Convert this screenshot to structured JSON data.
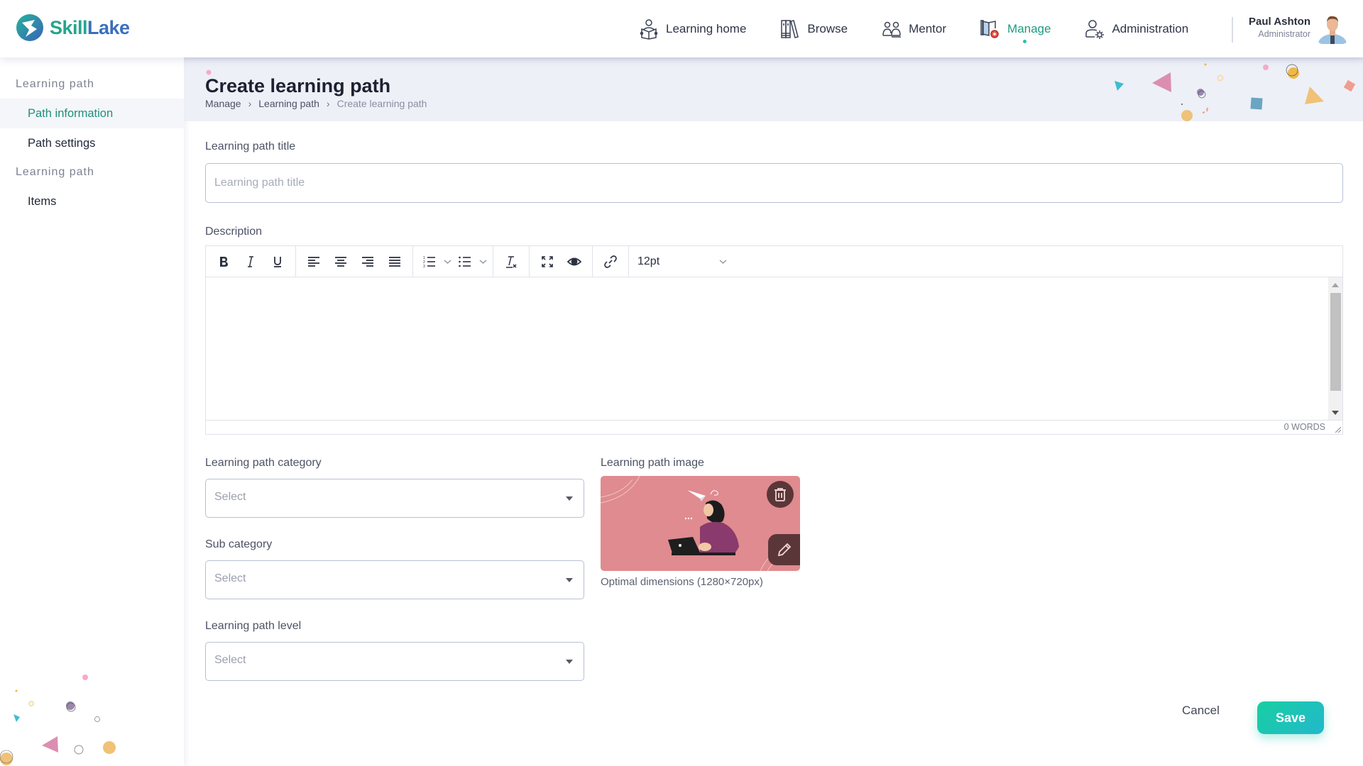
{
  "app": {
    "brand_part1": "Skill",
    "brand_part2": "Lake",
    "colors": {
      "accent": "#1f9a80",
      "brand_green": "#25a58c",
      "brand_blue": "#3a6fbd",
      "save_start": "#18cfa2",
      "save_end": "#22b8cc"
    }
  },
  "nav": {
    "items": [
      {
        "label": "Learning home",
        "icon": "reading-person-icon",
        "active": false
      },
      {
        "label": "Browse",
        "icon": "bookshelf-icon",
        "active": false
      },
      {
        "label": "Mentor",
        "icon": "people-icon",
        "active": false
      },
      {
        "label": "Manage",
        "icon": "book-gear-icon",
        "active": true
      },
      {
        "label": "Administration",
        "icon": "user-gear-icon",
        "active": false
      }
    ]
  },
  "user": {
    "name": "Paul Ashton",
    "role": "Administrator"
  },
  "sidebar": {
    "sections": [
      {
        "title": "Learning path",
        "items": [
          {
            "label": "Path information",
            "active": true
          },
          {
            "label": "Path settings",
            "active": false
          }
        ]
      },
      {
        "title": "Learning path",
        "items": [
          {
            "label": "Items",
            "active": false
          }
        ]
      }
    ]
  },
  "page": {
    "title": "Create learning path",
    "breadcrumb": [
      "Manage",
      "Learning path",
      "Create learning path"
    ],
    "breadcrumb_separator": "›"
  },
  "form": {
    "title_label": "Learning path title",
    "title_value": "",
    "title_placeholder": "Learning path title",
    "description_label": "Description",
    "editor": {
      "toolbar": [
        "bold",
        "italic",
        "underline",
        "align-left",
        "align-center",
        "align-right",
        "align-justify",
        "numbered-list",
        "bullet-list",
        "clear-formatting",
        "fullscreen",
        "preview",
        "link"
      ],
      "font_size": "12pt",
      "word_count": "0 WORDS",
      "content": ""
    },
    "category_label": "Learning path category",
    "category_value": "Select",
    "subcategory_label": "Sub category",
    "subcategory_value": "Select",
    "level_label": "Learning path level",
    "level_value": "Select",
    "image_label": "Learning path image",
    "image_hint": "Optimal dimensions (1280×720px)"
  },
  "actions": {
    "cancel": "Cancel",
    "save": "Save"
  }
}
